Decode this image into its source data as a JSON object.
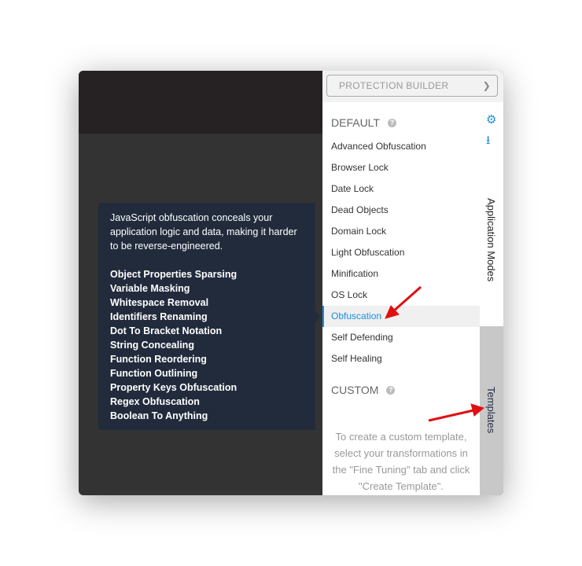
{
  "dropdown": {
    "label": "PROTECTION BUILDER"
  },
  "default_section": {
    "title": "DEFAULT",
    "items": [
      "Advanced Obfuscation",
      "Browser Lock",
      "Date Lock",
      "Dead Objects",
      "Domain Lock",
      "Light Obfuscation",
      "Minification",
      "OS Lock",
      "Obfuscation",
      "Self Defending",
      "Self Healing"
    ],
    "selected": "Obfuscation"
  },
  "custom_section": {
    "title": "CUSTOM",
    "message": "To create a custom template, select your transformations in the \"Fine Tuning\" tab and click \"Create Template\"."
  },
  "side_tabs": {
    "application_modes": "Application Modes",
    "templates": "Templates"
  },
  "tooltip": {
    "description": "JavaScript obfuscation conceals your application logic and data, making it harder to be reverse-engineered.",
    "features": [
      "Object Properties Sparsing",
      "Variable Masking",
      "Whitespace Removal",
      "Identifiers Renaming",
      "Dot To Bracket Notation",
      "String Concealing",
      "Function Reordering",
      "Function Outlining",
      "Property Keys Obfuscation",
      "Regex Obfuscation",
      "Boolean To Anything"
    ]
  },
  "colors": {
    "accent": "#1a8fe0",
    "annotation_arrow": "#e01010",
    "tooltip_bg": "#222b3c"
  }
}
